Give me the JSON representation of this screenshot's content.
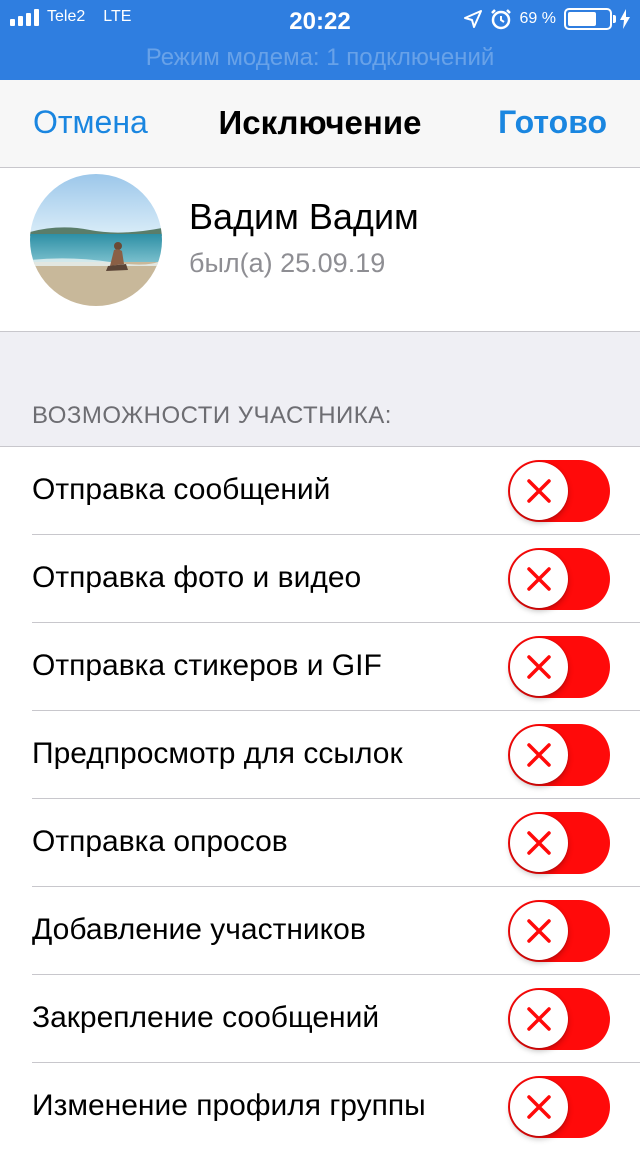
{
  "status_bar": {
    "carrier": "Tele2",
    "network": "LTE",
    "time": "20:22",
    "battery": "69 %",
    "battery_level": 0.69,
    "banner_text": "Режим модема: 1 подключений"
  },
  "nav": {
    "cancel": "Отмена",
    "title": "Исключение",
    "done": "Готово"
  },
  "profile": {
    "name": "Вадим Вадим",
    "status": "был(а) 25.09.19"
  },
  "section": {
    "header": "ВОЗМОЖНОСТИ УЧАСТНИКА:"
  },
  "permissions": [
    {
      "label": "Отправка сообщений",
      "enabled": false
    },
    {
      "label": "Отправка фото и видео",
      "enabled": false
    },
    {
      "label": "Отправка стикеров и GIF",
      "enabled": false
    },
    {
      "label": "Предпросмотр для ссылок",
      "enabled": false
    },
    {
      "label": "Отправка опросов",
      "enabled": false
    },
    {
      "label": "Добавление участников",
      "enabled": false
    },
    {
      "label": "Закрепление сообщений",
      "enabled": false
    },
    {
      "label": "Изменение профиля группы",
      "enabled": false
    }
  ],
  "colors": {
    "accent": "#1a86e0",
    "status_bar": "#2f7ee0",
    "toggle_off": "#ff0a0a"
  },
  "icons": {
    "toggle_knob": "close-icon"
  }
}
